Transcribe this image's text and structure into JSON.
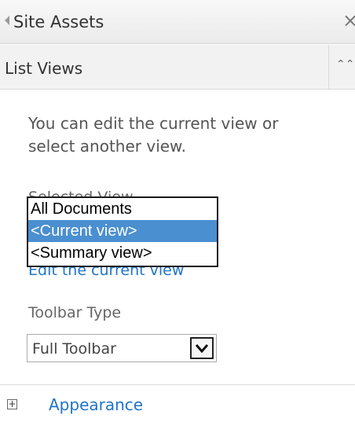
{
  "panel": {
    "title": "Site Assets",
    "close_symbol": "×"
  },
  "section": {
    "title": "List Views",
    "collapse_symbol": "⌃⌃"
  },
  "description": "You can edit the current view or select another view.",
  "selected_view": {
    "label": "Selected View",
    "options": [
      "All Documents",
      "<Current view>",
      "<Summary view>"
    ],
    "selected_index": 1
  },
  "edit_link": "Edit the current view",
  "toolbar": {
    "label": "Toolbar Type",
    "value": "Full Toolbar"
  },
  "appearance": {
    "expander_symbol": "+",
    "label": "Appearance"
  },
  "colors": {
    "link": "#1f74c9",
    "selection": "#4a8fd0"
  }
}
